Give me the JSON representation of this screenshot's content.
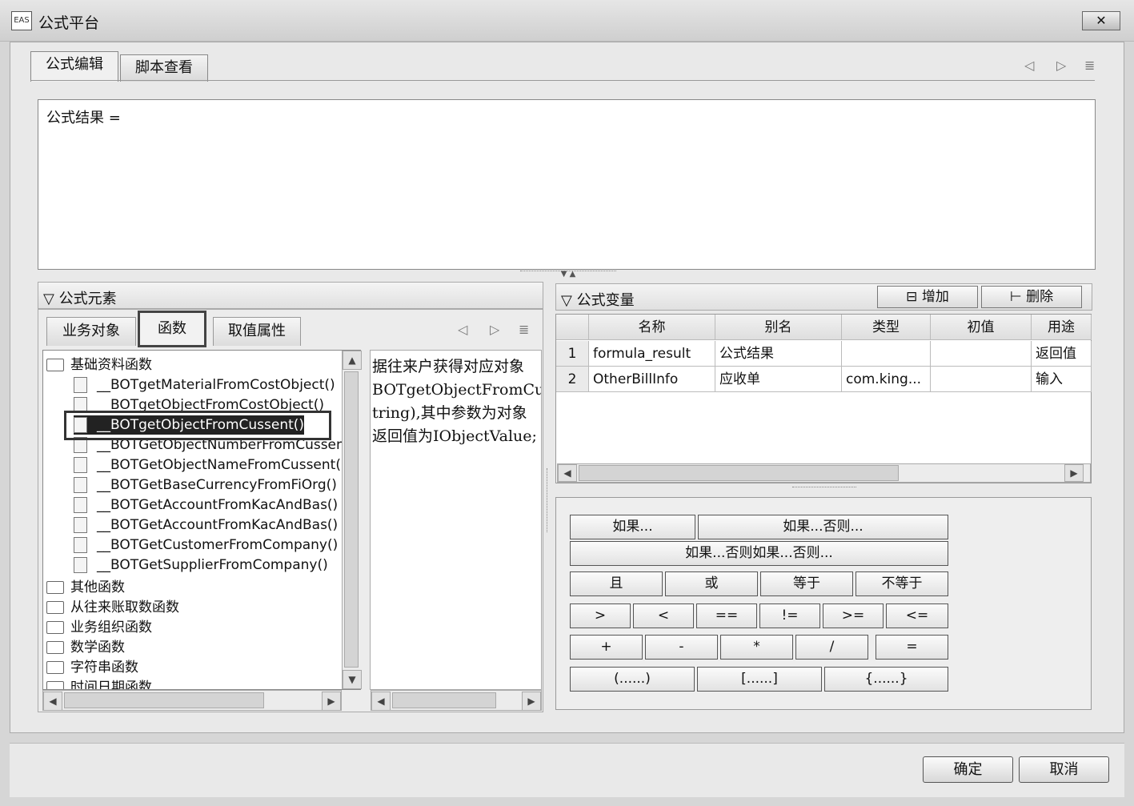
{
  "window": {
    "app_icon_text": "EAS",
    "title": "公式平台",
    "close_label": "✕"
  },
  "tabs": [
    {
      "label": "公式编辑"
    },
    {
      "label": "脚本查看"
    }
  ],
  "nav": {
    "prev": "◁",
    "next": "▷",
    "menu": "≣"
  },
  "editor": {
    "text": "公式结果 ="
  },
  "elements_panel": {
    "title": "公式元素",
    "tabs": [
      {
        "label": "业务对象"
      },
      {
        "label": "函数"
      },
      {
        "label": "取值属性"
      }
    ],
    "tree": {
      "root": "基础资料函数",
      "children": [
        "__BOTgetMaterialFromCostObject()",
        "__BOTgetObjectFromCostObject()",
        "__BOTgetObjectFromCussent()",
        "__BOTGetObjectNumberFromCussent()",
        "__BOTGetObjectNameFromCussent()",
        "__BOTGetBaseCurrencyFromFiOrg()",
        "__BOTGetAccountFromKacAndBas()",
        "__BOTGetAccountFromKacAndBas()",
        "__BOTGetCustomerFromCompany()",
        "__BOTGetSupplierFromCompany()"
      ],
      "folders": [
        "其他函数",
        "从往来账取数函数",
        "业务组织函数",
        "数学函数",
        "字符串函数",
        "时间日期函数"
      ]
    },
    "description": [
      "据往来户获得对应对象",
      "BOTgetObjectFromCussent(String",
      "tring),其中参数为对象",
      "返回值为IObjectValue;"
    ]
  },
  "variables_panel": {
    "title": "公式变量",
    "add_label": "增加",
    "delete_label": "删除",
    "columns": [
      "名称",
      "别名",
      "类型",
      "初值",
      "用途"
    ],
    "rows": [
      {
        "num": "1",
        "name": "formula_result",
        "alias": "公式结果",
        "type": "",
        "init": "",
        "usage": "返回值"
      },
      {
        "num": "2",
        "name": "OtherBillInfo",
        "alias": "应收单",
        "type": "com.king...",
        "init": "",
        "usage": "输入"
      }
    ]
  },
  "operators": {
    "if": "如果...",
    "if_else": "如果...否则...",
    "if_elseif_else": "如果...否则如果...否则...",
    "logic": [
      "且",
      "或",
      "等于",
      "不等于"
    ],
    "compare": [
      ">",
      "<",
      "==",
      "!=",
      ">=",
      "<="
    ],
    "arith": [
      "+",
      "-",
      "*",
      "/",
      "="
    ],
    "brackets": [
      "(......)",
      "[......]",
      "{......}"
    ]
  },
  "footer": {
    "ok": "确定",
    "cancel": "取消"
  }
}
